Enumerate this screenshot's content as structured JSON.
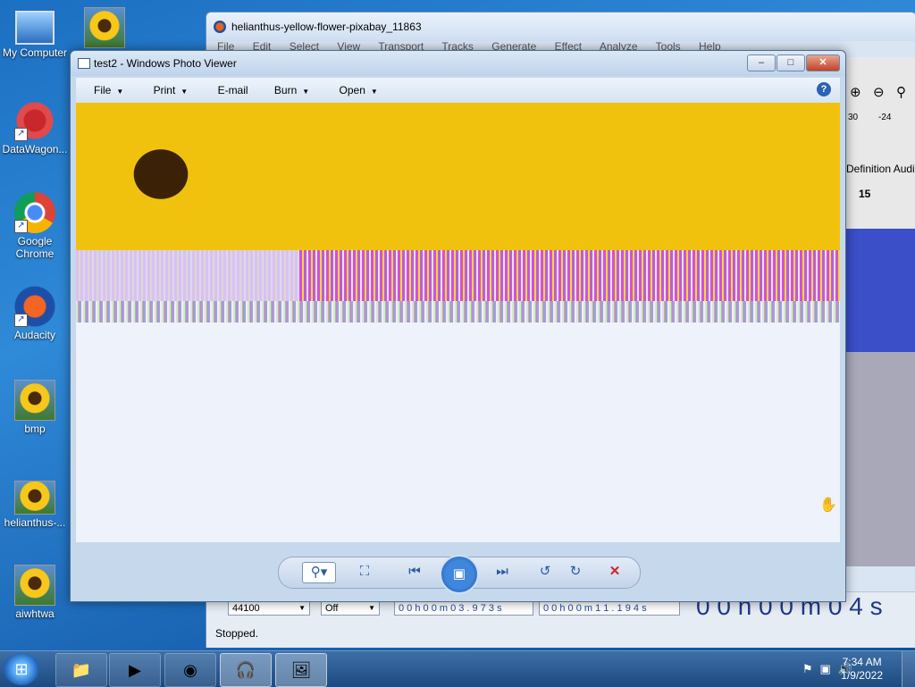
{
  "desktop": {
    "icons": [
      {
        "label": "My Computer",
        "icon": "computer-icon"
      },
      {
        "label": "DataWagon...",
        "icon": "datawagon-icon"
      },
      {
        "label": "Google Chrome",
        "icon": "chrome-icon"
      },
      {
        "label": "Audacity",
        "icon": "audacity-icon"
      },
      {
        "label": "bmp",
        "icon": "image-file-icon"
      },
      {
        "label": "helianthus-...",
        "icon": "image-file-icon"
      },
      {
        "label": "aiwhtwa",
        "icon": "image-file-icon"
      }
    ]
  },
  "audacity": {
    "title": "helianthus-yellow-flower-pixabay_11863",
    "menu": [
      "File",
      "Edit",
      "Select",
      "View",
      "Transport",
      "Tracks",
      "Generate",
      "Effect",
      "Analyze",
      "Tools",
      "Help"
    ],
    "meter_ticks": [
      "30",
      "-24"
    ],
    "device_label": "Definition Audi",
    "ruler_mark": "15",
    "project_rate": "44100",
    "snap_to": "Off",
    "selection_start": "0 0 h 0 0 m 0 3 . 9 7 3 s",
    "selection_end": "0 0 h 0 0 m 1 1 . 1 9 4 s",
    "big_time": "0 0 h 0 0 m 0 4 s",
    "status": "Stopped."
  },
  "photo_viewer": {
    "title": "test2 - Windows Photo Viewer",
    "menu": [
      {
        "label": "File",
        "has_dropdown": true
      },
      {
        "label": "Print",
        "has_dropdown": true
      },
      {
        "label": "E-mail",
        "has_dropdown": false
      },
      {
        "label": "Burn",
        "has_dropdown": true
      },
      {
        "label": "Open",
        "has_dropdown": true
      }
    ],
    "help": "?",
    "window_buttons": {
      "minimize": "–",
      "maximize": "□",
      "close": "✕"
    },
    "controls": {
      "zoom": "⚲▾",
      "fit": "⛶",
      "previous": "⏮",
      "slideshow": "▣",
      "next": "⏭",
      "rotate_ccw": "↺",
      "rotate_cw": "↻",
      "delete": "✕"
    },
    "cursor": "✋"
  },
  "taskbar": {
    "start": "⊞",
    "buttons": [
      {
        "name": "explorer",
        "glyph": "📁"
      },
      {
        "name": "media-player",
        "glyph": "▶"
      },
      {
        "name": "chrome",
        "glyph": "◉"
      },
      {
        "name": "audacity",
        "glyph": "🎧"
      },
      {
        "name": "photo-viewer",
        "glyph": "🖼"
      }
    ],
    "time": "7:34 AM",
    "date": "1/9/2022"
  }
}
